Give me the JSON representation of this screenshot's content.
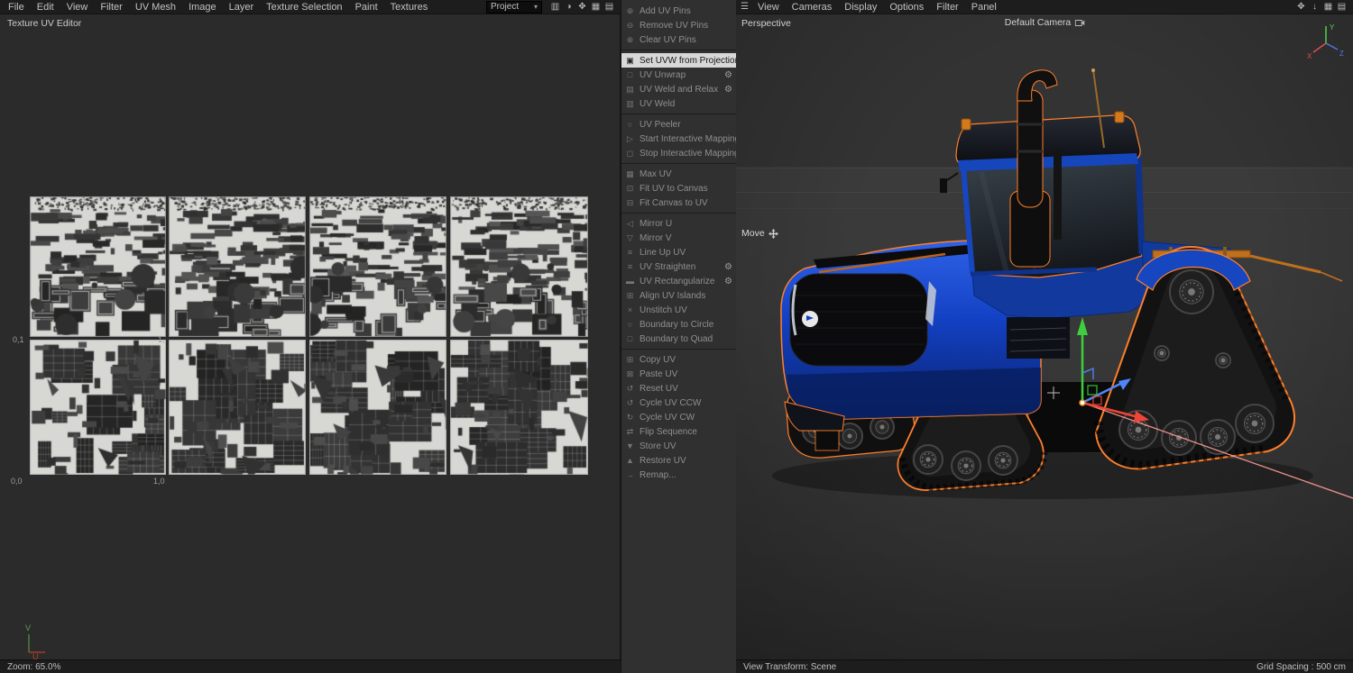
{
  "left_editor": {
    "title": "Texture UV Editor",
    "menu": [
      "File",
      "Edit",
      "View",
      "Filter",
      "UV Mesh",
      "Image",
      "Layer",
      "Texture Selection",
      "Paint",
      "Textures"
    ],
    "project": "Project",
    "toolbar_right_icons": [
      "histogram",
      "palette",
      "pan",
      "grid",
      "page"
    ],
    "corner_labels": {
      "tl": "0,1",
      "tr": "1,",
      "bl": "0,0",
      "br": "1,0"
    },
    "axis": {
      "v": "V",
      "u": "U"
    },
    "zoom": "Zoom: 65.0%"
  },
  "uv_commands": {
    "items": [
      {
        "label": "Add UV Pins",
        "icon": "⊕"
      },
      {
        "label": "Remove UV Pins",
        "icon": "⊖"
      },
      {
        "label": "Clear UV Pins",
        "icon": "⊗"
      },
      {
        "type": "sep"
      },
      {
        "label": "Set UVW from Projection",
        "icon": "▣",
        "gear": true,
        "selected": true
      },
      {
        "label": "UV Unwrap",
        "icon": "□",
        "gear": true
      },
      {
        "label": "UV Weld and Relax",
        "icon": "▤",
        "gear": true
      },
      {
        "label": "UV Weld",
        "icon": "▥"
      },
      {
        "type": "sep"
      },
      {
        "label": "UV Peeler",
        "icon": "○"
      },
      {
        "label": "Start Interactive Mapping",
        "icon": "▷"
      },
      {
        "label": "Stop Interactive Mapping",
        "icon": "◻"
      },
      {
        "type": "sep"
      },
      {
        "label": "Max UV",
        "icon": "▦"
      },
      {
        "label": "Fit UV to Canvas",
        "icon": "⊡"
      },
      {
        "label": "Fit Canvas to UV",
        "icon": "⊟"
      },
      {
        "type": "sep"
      },
      {
        "label": "Mirror U",
        "icon": "◁"
      },
      {
        "label": "Mirror V",
        "icon": "▽"
      },
      {
        "label": "Line Up UV",
        "icon": "≡"
      },
      {
        "label": "UV Straighten",
        "icon": "≡",
        "gear": true
      },
      {
        "label": "UV Rectangularize",
        "icon": "▬",
        "gear": true
      },
      {
        "label": "Align UV Islands",
        "icon": "⊞"
      },
      {
        "label": "Unstitch UV",
        "icon": "×"
      },
      {
        "label": "Boundary to Circle",
        "icon": "○"
      },
      {
        "label": "Boundary to Quad",
        "icon": "□"
      },
      {
        "type": "sep"
      },
      {
        "label": "Copy UV",
        "icon": "⊞"
      },
      {
        "label": "Paste UV",
        "icon": "⊠"
      },
      {
        "label": "Reset UV",
        "icon": "↺"
      },
      {
        "label": "Cycle UV CCW",
        "icon": "↺"
      },
      {
        "label": "Cycle UV CW",
        "icon": "↻"
      },
      {
        "label": "Flip Sequence",
        "icon": "⇄"
      },
      {
        "label": "Store UV",
        "icon": "▼"
      },
      {
        "label": "Restore UV",
        "icon": "▲"
      },
      {
        "label": "Remap...",
        "icon": "→"
      }
    ]
  },
  "viewport": {
    "menu": [
      "View",
      "Cameras",
      "Display",
      "Options",
      "Filter",
      "Panel"
    ],
    "toolbar_left_icons": [
      "menu"
    ],
    "toolbar_right_icons": [
      "pan",
      "down",
      "grid",
      "page"
    ],
    "view_label": "Perspective",
    "camera_label": "Default Camera",
    "tool_label": "Move",
    "status_left": "View Transform: Scene",
    "status_right": "Grid Spacing : 500 cm",
    "gizmo_axes": {
      "x": "X",
      "y": "Y",
      "z": "Z"
    }
  },
  "colors": {
    "selection_outline": "#ff7f2a",
    "tractor_blue": "#1646c0",
    "menu_highlight": "#d8d8d8",
    "axis_x": "#e04f4f",
    "axis_y": "#4fd24f",
    "axis_z": "#4f78e0"
  }
}
